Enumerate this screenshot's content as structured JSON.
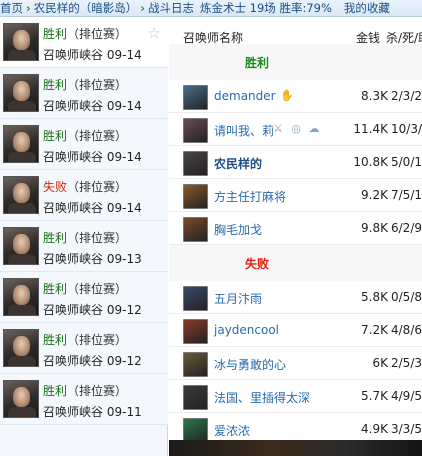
{
  "breadcrumb": {
    "home": "首页",
    "player": "农民样的（暗影岛）",
    "log": "战斗日志",
    "stats": "炼金术士 19场 胜率:79%",
    "favorite": "我的收藏"
  },
  "matches": [
    {
      "result": "胜利",
      "queue": "（排位赛）",
      "map": "召唤师峡谷",
      "date": "09-14",
      "win": true,
      "selected": true,
      "star": "☆"
    },
    {
      "result": "胜利",
      "queue": "（排位赛）",
      "map": "召唤师峡谷",
      "date": "09-14",
      "win": true
    },
    {
      "result": "胜利",
      "queue": "（排位赛）",
      "map": "召唤师峡谷",
      "date": "09-14",
      "win": true
    },
    {
      "result": "失败",
      "queue": "（排位赛）",
      "map": "召唤师峡谷",
      "date": "09-14",
      "win": false
    },
    {
      "result": "胜利",
      "queue": "（排位赛）",
      "map": "召唤师峡谷",
      "date": "09-13",
      "win": true
    },
    {
      "result": "胜利",
      "queue": "（排位赛）",
      "map": "召唤师峡谷",
      "date": "09-12",
      "win": true
    },
    {
      "result": "胜利",
      "queue": "（排位赛）",
      "map": "召唤师峡谷",
      "date": "09-12",
      "win": true
    },
    {
      "result": "胜利",
      "queue": "（排位赛）",
      "map": "召唤师峡谷",
      "date": "09-11",
      "win": true
    }
  ],
  "table": {
    "col_name": "召唤师名称",
    "col_gold": "金钱",
    "col_kda": "杀/死/助"
  },
  "win_section": "胜利",
  "loss_section": "失败",
  "win_players": [
    {
      "name": "demander",
      "gold": "8.3K",
      "kda": "2/3/2",
      "champ_color": "#4a6e8a",
      "icons": [
        "hand-icon"
      ]
    },
    {
      "name": "请叫我、莉",
      "gold": "11.4K",
      "kda": "10/3/",
      "champ_color": "#6a4a5a",
      "icons": [
        "sword-icon",
        "pill-icon",
        "cloud-icon"
      ]
    },
    {
      "name": "农民样的",
      "gold": "10.8K",
      "kda": "5/0/1",
      "champ_color": "#4a4442",
      "me": true,
      "icons": []
    },
    {
      "name": "方主任打麻将",
      "gold": "9.2K",
      "kda": "7/5/1",
      "champ_color": "#8a5a2a",
      "icons": []
    },
    {
      "name": "胸毛加戈",
      "gold": "9.8K",
      "kda": "6/2/9",
      "champ_color": "#7a4a2a",
      "icons": []
    }
  ],
  "loss_players": [
    {
      "name": "五月汴雨",
      "gold": "5.8K",
      "kda": "0/5/8",
      "champ_color": "#3a4a6a",
      "icons": []
    },
    {
      "name": "jaydencool",
      "gold": "7.2K",
      "kda": "4/8/6",
      "champ_color": "#8a3a2a",
      "icons": []
    },
    {
      "name": "冰与勇敢的心",
      "gold": "6K",
      "kda": "2/5/3",
      "champ_color": "#6a5a3a",
      "icons": []
    },
    {
      "name": "法国、里插得太深",
      "gold": "5.7K",
      "kda": "4/9/5",
      "champ_color": "#3a3a3a",
      "icons": []
    },
    {
      "name": "爱浓浓",
      "gold": "4.9K",
      "kda": "3/3/5",
      "champ_color": "#2a7a4a",
      "icons": []
    }
  ]
}
